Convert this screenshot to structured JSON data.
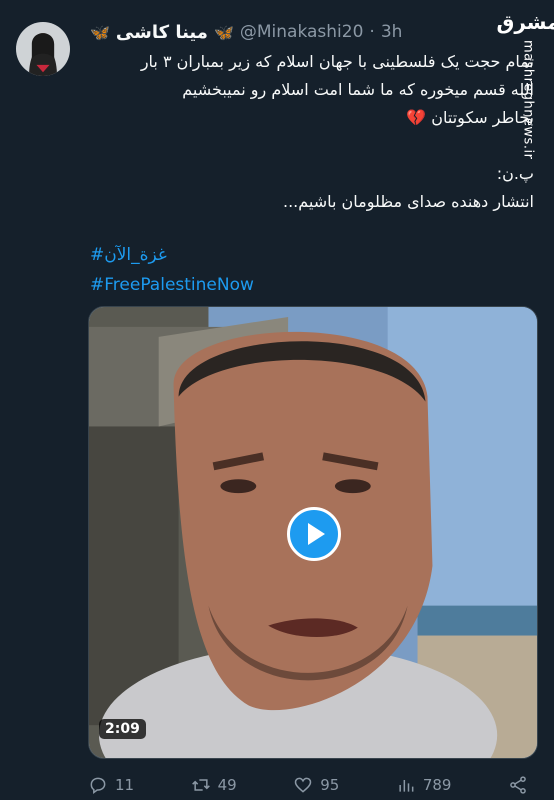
{
  "author": {
    "display_name": "مینا کاشی",
    "emoji": "🦋",
    "handle": "@Minakashi20",
    "separator": "·",
    "time": "3h"
  },
  "tweet": {
    "lines": [
      "تمام حجت یک فلسطینی با جهان اسلام که زیر بمباران ۳ بار",
      "الله قسم میخوره که ما شما امت اسلام رو نمیبخشیم",
      "بخاطر سکوتتان 💔"
    ],
    "ps_label": "پ.ن:",
    "ps_text": "انتشار دهنده صدای مظلومان باشیم...",
    "hashtags": [
      "غزة_الآن#",
      "#FreePalestineNow"
    ]
  },
  "watermark": {
    "logo": "مشرق",
    "site": "mashreghnews.ir"
  },
  "media": {
    "duration": "2:09",
    "play_icon": "play-icon"
  },
  "actions": {
    "replies": "11",
    "retweets": "49",
    "likes": "95",
    "views": "789"
  },
  "colors": {
    "background": "#15202b",
    "accent": "#1d9bf0",
    "muted": "#8b98a5"
  }
}
